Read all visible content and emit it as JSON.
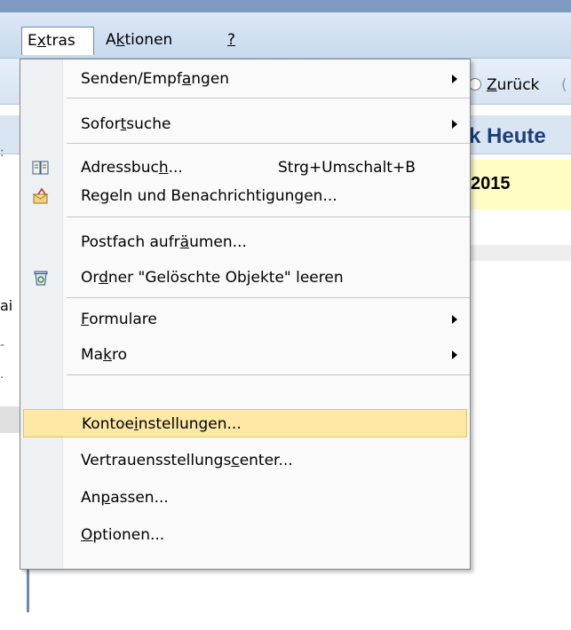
{
  "menubar": {
    "extras": {
      "pre": "E",
      "acc": "x",
      "post": "tras"
    },
    "aktionen": {
      "pre": "A",
      "acc": "k",
      "post": "tionen"
    },
    "help": {
      "acc": "?"
    }
  },
  "background": {
    "zurueck": {
      "acc": "Z",
      "post": "urück"
    },
    "heute": "k Heute",
    "year": "2015",
    "stub_a": "ai",
    "stub_b": "-",
    "stub_c": ":",
    "stub_d": "·",
    "stub2": "("
  },
  "extras_menu": {
    "items": [
      {
        "pre": "Senden/Empf",
        "acc": "a",
        "post": "ngen",
        "submenu": true
      },
      {
        "pre": "Sofor",
        "acc": "t",
        "post": "suche",
        "submenu": true
      },
      {
        "pre": "Adressbuc",
        "acc": "h",
        "post": "...",
        "shortcut": "Strg+Umschalt+B",
        "icon": "address-book-icon"
      },
      {
        "pre": "Re",
        "acc": "g",
        "post": "eln und Benachrichtigungen...",
        "icon": "rules-icon"
      },
      {
        "pre": "Postfach aufr",
        "acc": "ä",
        "post": "umen..."
      },
      {
        "pre": "Or",
        "acc": "d",
        "post": "ner \"Gelöschte Objekte\" leeren",
        "icon": "recycle-bin-icon"
      },
      {
        "pre": "",
        "acc": "F",
        "post": "ormulare",
        "submenu": true
      },
      {
        "pre": "Ma",
        "acc": "k",
        "post": "ro",
        "submenu": true
      },
      {
        "pre": "Kontoe",
        "acc": "i",
        "post": "nstellungen...",
        "highlighted": true
      },
      {
        "pre": "Vertrauensstellungs",
        "acc": "c",
        "post": "enter..."
      },
      {
        "pre": "An",
        "acc": "p",
        "post": "assen..."
      },
      {
        "pre": "",
        "acc": "O",
        "post": "ptionen..."
      }
    ]
  },
  "colors": {
    "highlight": "#fde8a6",
    "highlight_border": "#e5c365",
    "heute_text": "#1c3f7a",
    "date_bg": "#fffcc4"
  }
}
